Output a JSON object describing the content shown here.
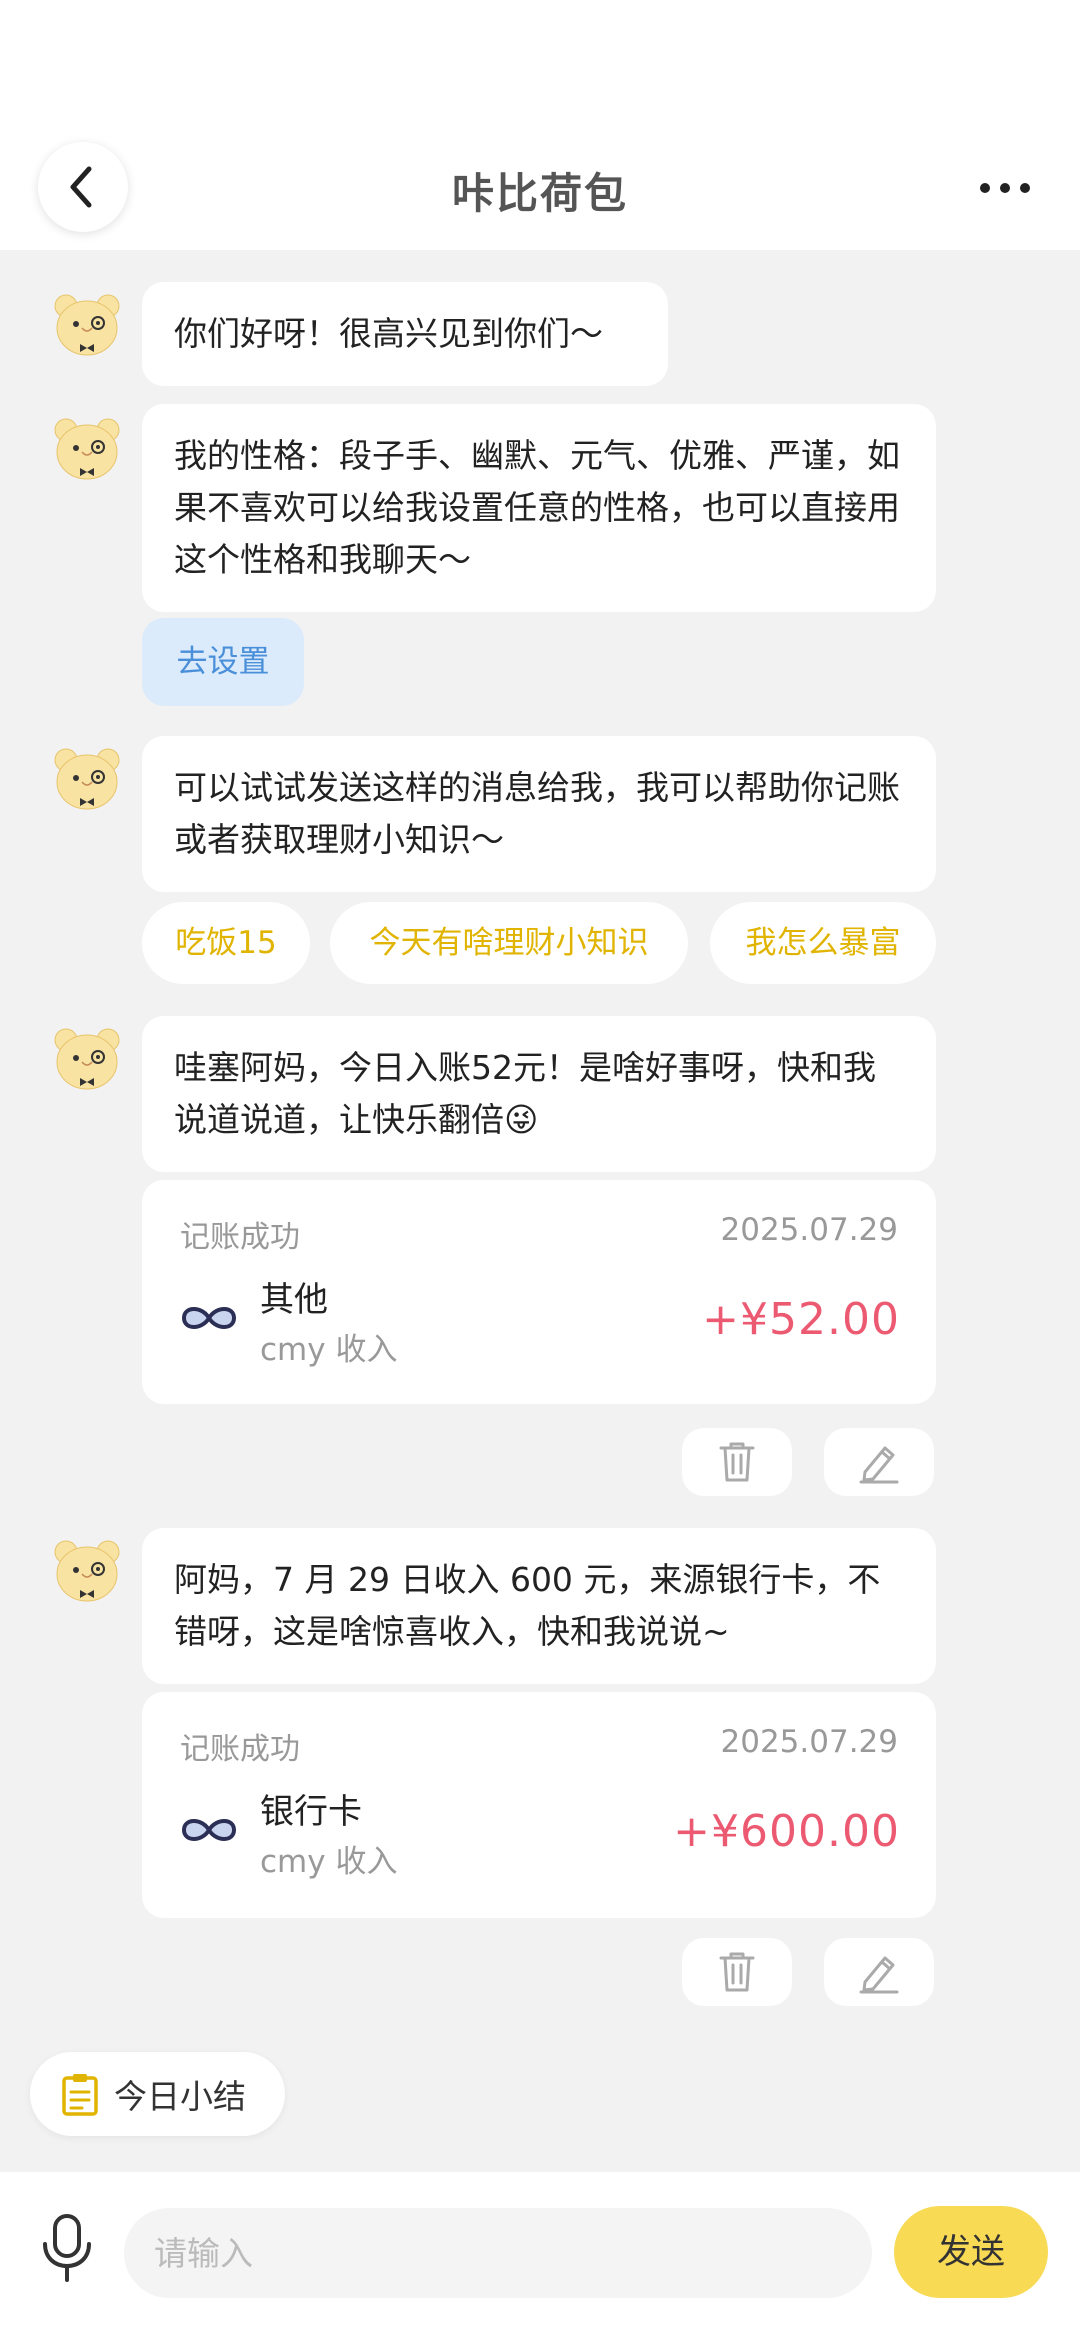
{
  "header": {
    "title": "咔比荷包"
  },
  "messages": [
    {
      "text": "你们好呀！很高兴见到你们～"
    },
    {
      "text": "我的性格：段子手、幽默、元气、优雅、严谨，如果不喜欢可以给我设置任意的性格，也可以直接用这个性格和我聊天～"
    },
    {
      "text": "可以试试发送这样的消息给我，我可以帮助你记账或者获取理财小知识～"
    },
    {
      "text": "哇塞阿妈，今日入账52元！是啥好事呀，快和我说道说道，让快乐翻倍😜"
    },
    {
      "text": "阿妈，7 月 29 日收入 600 元，来源银行卡，不错呀，这是啥惊喜收入，快和我说说~"
    }
  ],
  "setting_button": "去设置",
  "suggestions": [
    "吃饭15",
    "今天有啥理财小知识",
    "我怎么暴富"
  ],
  "records": [
    {
      "status": "记账成功",
      "date": "2025.07.29",
      "category": "其他",
      "sub": "cmy 收入",
      "amount": "+¥52.00"
    },
    {
      "status": "记账成功",
      "date": "2025.07.29",
      "category": "银行卡",
      "sub": "cmy 收入",
      "amount": "+¥600.00"
    }
  ],
  "summary": {
    "label": "今日小结"
  },
  "input": {
    "placeholder": "请输入",
    "send": "发送"
  },
  "colors": {
    "accent_yellow": "#f8da55",
    "chip_text": "#e0b400",
    "amount_red": "#ec5a72",
    "link_blue": "#4a8fd9"
  },
  "icons": {
    "back": "chevron-left-icon",
    "more": "more-dots-icon",
    "avatar": "bear-avatar-icon",
    "infinity": "infinity-icon",
    "delete": "trash-icon",
    "edit": "pencil-icon",
    "summary": "clipboard-icon",
    "mic": "microphone-icon"
  }
}
